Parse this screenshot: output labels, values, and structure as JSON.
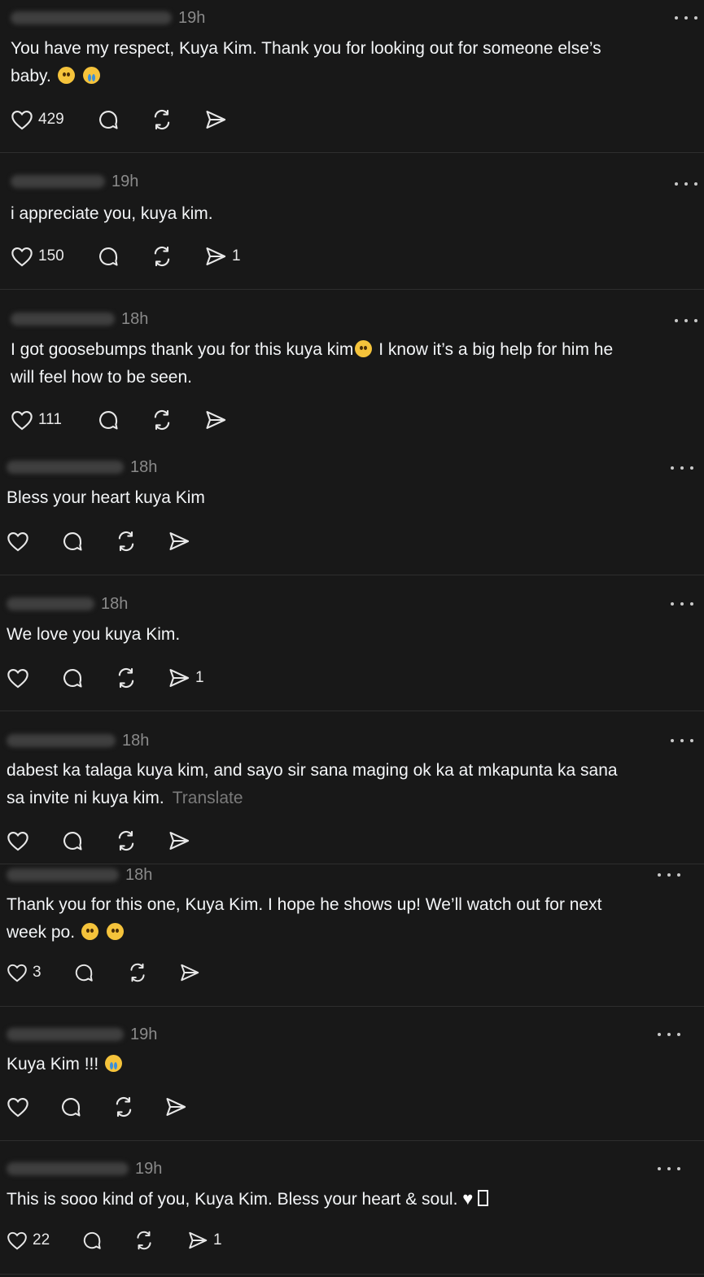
{
  "posts": [
    {
      "time": "19h",
      "text": "You have my respect, Kuya Kim. Thank you for looking out for someone else’s\nbaby. ",
      "likes": "429",
      "shares": ""
    },
    {
      "time": "19h",
      "text": "i appreciate you, kuya kim.",
      "likes": "150",
      "shares": "1"
    },
    {
      "time": "18h",
      "text": "I got goosebumps thank you for this kuya kim",
      "text2": " I know it’s a big help for him he\nwill feel how to be seen.",
      "likes": "111",
      "shares": ""
    },
    {
      "time": "18h",
      "text": "Bless your heart kuya Kim",
      "likes": "",
      "shares": ""
    },
    {
      "time": "18h",
      "text": "We love you kuya Kim.",
      "likes": "",
      "shares": "1"
    },
    {
      "time": "18h",
      "text": "dabest ka talaga kuya kim, and sayo sir sana maging ok ka at mkapunta ka sana\nsa invite ni kuya kim.",
      "translate": "Translate",
      "likes": "",
      "shares": ""
    },
    {
      "time": "18h",
      "text": "Thank you for this one, Kuya Kim. I hope he shows up! We’ll watch out for next\nweek po. ",
      "likes": "3",
      "shares": ""
    },
    {
      "time": "19h",
      "text": "Kuya Kim !!! ",
      "likes": "",
      "shares": ""
    },
    {
      "time": "19h",
      "text": "This is sooo kind of you, Kuya Kim. Bless your heart & soul. ",
      "likes": "22",
      "shares": "1"
    }
  ]
}
